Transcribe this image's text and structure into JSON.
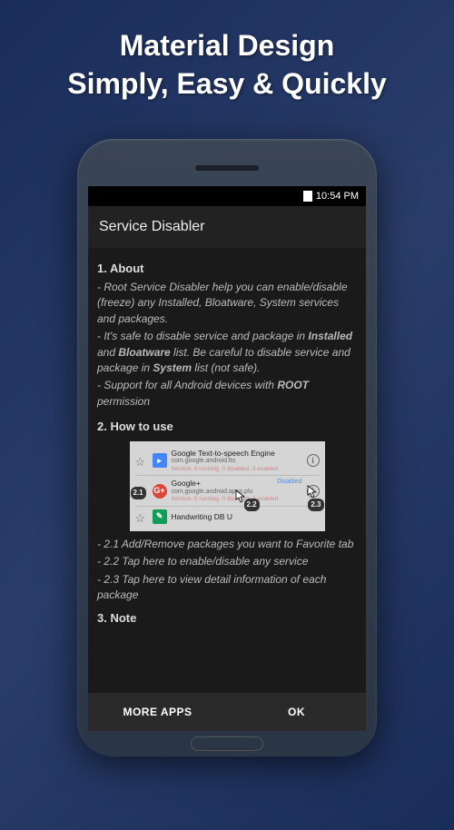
{
  "promo": {
    "line1": "Material Design",
    "line2": "Simply, Easy & Quickly"
  },
  "status_bar": {
    "time": "10:54 PM"
  },
  "app_bar": {
    "title": "Service Disabler"
  },
  "sections": {
    "about": {
      "title": "1. About",
      "p1_pre": " - Root Service Disabler help you can enable/disable (freeze) any Installed, Bloatware, System services and packages.",
      "p2_pre": " - It's safe to disable service and package in ",
      "p2_b1": "Installed",
      "p2_mid1": " and ",
      "p2_b2": "Bloatware",
      "p2_mid2": " list. Be careful to disable service and package in ",
      "p2_b3": "System",
      "p2_end": " list (not safe).",
      "p3_pre": " - Support for all Android devices with ",
      "p3_b1": "ROOT",
      "p3_end": " permission"
    },
    "howto": {
      "title": "2. How to use",
      "items": [
        {
          "name": "Google Text-to-speech Engine",
          "pkg": "com.google.android.tts",
          "status": "Service: 0 running, 0 disabled, 3 enabled"
        },
        {
          "name": "Google+",
          "pkg": "com.google.android.apps.plu",
          "status": "Service: 0 running, 0 disabled, 3 enabled",
          "disabled": "Disabled"
        },
        {
          "name": "Handwriting DB U",
          "pkg": "",
          "status": ""
        }
      ],
      "badges": {
        "b21": "2.1",
        "b22": "2.2",
        "b23": "2.3"
      },
      "step1": " - 2.1 Add/Remove packages you want to Favorite tab",
      "step2": " - 2.2 Tap here to enable/disable any service",
      "step3": " - 2.3 Tap here to view detail information of each package"
    },
    "note": {
      "title": "3. Note"
    }
  },
  "buttons": {
    "more_apps": "MORE APPS",
    "ok": "OK"
  }
}
